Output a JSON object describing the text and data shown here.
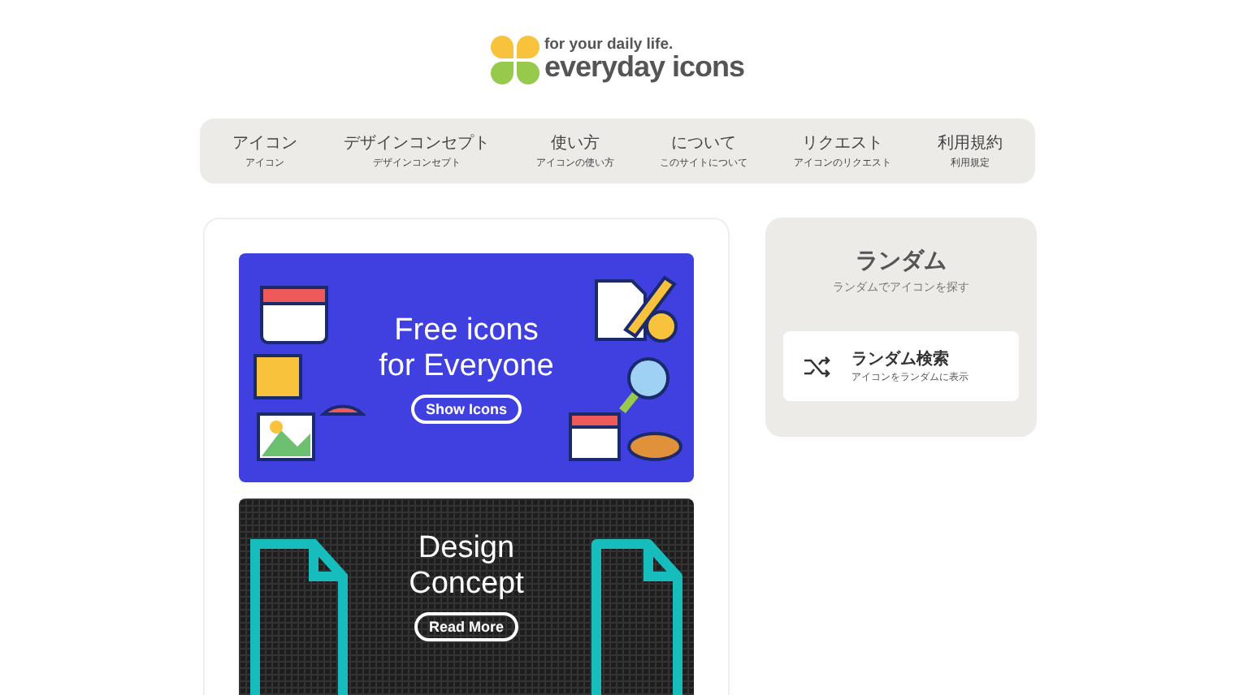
{
  "logo": {
    "tagline": "for your daily life.",
    "name": "everyday icons"
  },
  "nav": [
    {
      "label": "アイコン",
      "sub": "アイコン"
    },
    {
      "label": "デザインコンセプト",
      "sub": "デザインコンセプト"
    },
    {
      "label": "使い方",
      "sub": "アイコンの使い方"
    },
    {
      "label": "について",
      "sub": "このサイトについて"
    },
    {
      "label": "リクエスト",
      "sub": "アイコンのリクエスト"
    },
    {
      "label": "利用規約",
      "sub": "利用規定"
    }
  ],
  "banners": [
    {
      "kind": "icons",
      "title_lines": [
        "Free icons",
        "for Everyone"
      ],
      "button": "Show Icons"
    },
    {
      "kind": "concept",
      "title_lines": [
        "Design",
        "Concept"
      ],
      "button": "Read More"
    }
  ],
  "random": {
    "title": "ランダム",
    "subtitle": "ランダムでアイコンを探す",
    "item": {
      "title": "ランダム検索",
      "description": "アイコンをランダムに表示"
    }
  }
}
